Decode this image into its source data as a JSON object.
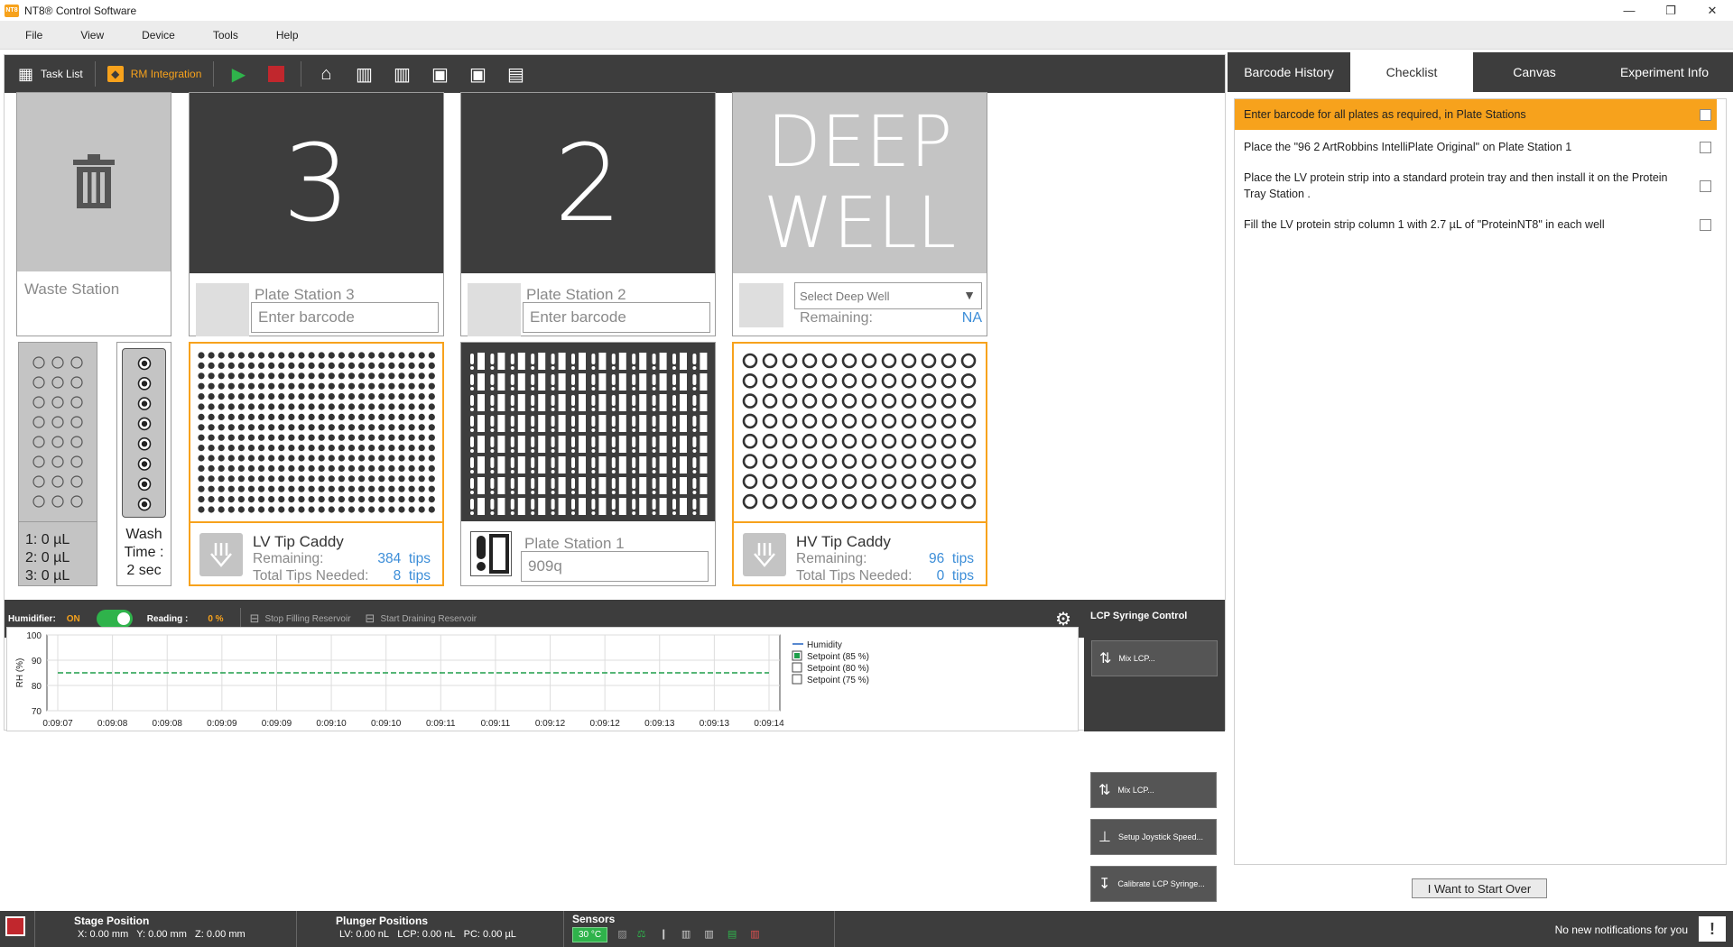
{
  "window": {
    "title": "NT8® Control Software",
    "app_icon_text": "NT8"
  },
  "menu": [
    "File",
    "View",
    "Device",
    "Tools",
    "Help"
  ],
  "toolbar": {
    "task_list": "Task List",
    "rm_integration": "RM Integration"
  },
  "stations": {
    "waste": {
      "label": "Waste Station"
    },
    "ps3": {
      "number": "3",
      "label": "Plate Station 3",
      "barcode_placeholder": "Enter barcode"
    },
    "ps2": {
      "number": "2",
      "label": "Plate Station 2",
      "barcode_placeholder": "Enter barcode"
    },
    "deep_well": {
      "line1": "DEEP",
      "line2": "WELL",
      "select_placeholder": "Select Deep Well",
      "remaining_label": "Remaining:",
      "remaining_value": "NA"
    },
    "reservoir": {
      "line1": "1: 0 µL",
      "line2": "2: 0 µL",
      "line3": "3: 0 µL"
    },
    "wash": {
      "line1": "Wash",
      "line2": "Time :",
      "line3": "2 sec"
    },
    "lv_tip": {
      "title": "LV Tip Caddy",
      "remaining_label": "Remaining:",
      "remaining_value": "384",
      "remaining_unit": "tips",
      "needed_label": "Total Tips Needed:",
      "needed_value": "8",
      "needed_unit": "tips"
    },
    "ps1": {
      "label": "Plate Station 1",
      "barcode_value": "909q"
    },
    "hv_tip": {
      "title": "HV Tip Caddy",
      "remaining_label": "Remaining:",
      "remaining_value": "96",
      "remaining_unit": "tips",
      "needed_label": "Total Tips Needed:",
      "needed_value": "0",
      "needed_unit": "tips"
    }
  },
  "humidity": {
    "humidifier_label": "Humidifier:",
    "humidifier_state": "ON",
    "reading_label": "Reading :",
    "reading_value": "0 %",
    "stop_fill": "Stop Filling Reservoir",
    "start_drain": "Start Draining Reservoir"
  },
  "chart_data": {
    "type": "line",
    "ylabel": "RH (%)",
    "ylim": [
      70,
      100
    ],
    "yticks": [
      70,
      80,
      90,
      100
    ],
    "x": [
      "0:09:07",
      "0:09:08",
      "0:09:08",
      "0:09:09",
      "0:09:09",
      "0:09:10",
      "0:09:10",
      "0:09:11",
      "0:09:11",
      "0:09:12",
      "0:09:12",
      "0:09:13",
      "0:09:13",
      "0:09:14"
    ],
    "grid": true,
    "legend": {
      "position": "right",
      "items": [
        {
          "name": "Humidity",
          "kind": "line",
          "color": "#2060c0"
        },
        {
          "name": "Setpoint (85 %)",
          "kind": "checkbox",
          "checked": true,
          "color": "#1e9e4a"
        },
        {
          "name": "Setpoint (80 %)",
          "kind": "checkbox",
          "checked": false
        },
        {
          "name": "Setpoint (75 %)",
          "kind": "checkbox",
          "checked": false
        }
      ]
    },
    "series": [
      {
        "name": "Setpoint (85 %)",
        "values": [
          85,
          85,
          85,
          85,
          85,
          85,
          85,
          85,
          85,
          85,
          85,
          85,
          85,
          85
        ],
        "color": "#1e9e4a",
        "dashed": true
      }
    ]
  },
  "lcp": {
    "title": "LCP Syringe Control",
    "buttons": [
      "Mix LCP...",
      "Setup Joystick Speed...",
      "Calibrate LCP Syringe..."
    ]
  },
  "right_panel": {
    "tabs": [
      "Barcode History",
      "Checklist",
      "Canvas",
      "Experiment Info"
    ],
    "active_tab": "Checklist",
    "checklist": [
      "Enter barcode for all plates as required, in Plate Stations",
      "Place the \"96 2 ArtRobbins IntelliPlate Original\" on Plate Station 1",
      "Place the LV protein strip into a standard protein tray and then install it on the Protein Tray Station .",
      "Fill the LV protein strip column 1 with 2.7 µL of \"ProteinNT8\" in each well"
    ],
    "start_over": "I Want to Start Over"
  },
  "status": {
    "stage_title": "Stage Position",
    "stage_x": "X: 0.00 mm",
    "stage_y": "Y: 0.00 mm",
    "stage_z": "Z: 0.00 mm",
    "plunger_title": "Plunger Positions",
    "plunger_lv": "LV: 0.00 nL",
    "plunger_lcp": "LCP: 0.00 nL",
    "plunger_pc": "PC: 0.00 µL",
    "sensors_title": "Sensors",
    "sensor_temp": "30 °C",
    "notifications": "No new notifications for you"
  },
  "colors": {
    "accent": "#f7a21c",
    "dark": "#3d3d3d",
    "link": "#3d8ed8",
    "ok": "#2fb34b",
    "stop": "#c1272d"
  }
}
